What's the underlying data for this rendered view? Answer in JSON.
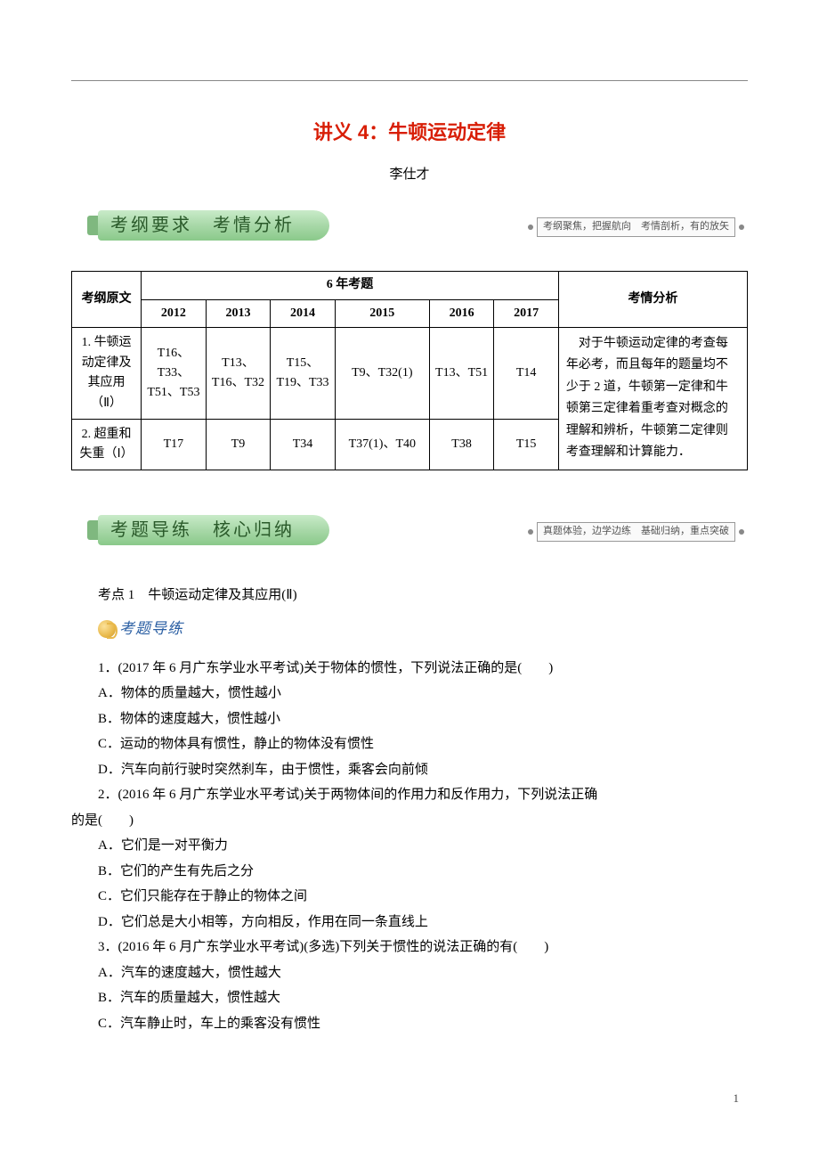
{
  "doc": {
    "title": "讲义 4：牛顿运动定律",
    "author": "李仕才"
  },
  "section1": {
    "ribbon": "考纲要求　考情分析",
    "note": "考纲聚焦，把握航向　考情剖析，有的放矢"
  },
  "table": {
    "header_outline": "考纲原文",
    "header_years_group": "6 年考题",
    "header_analysis": "考情分析",
    "years": [
      "2012",
      "2013",
      "2014",
      "2015",
      "2016",
      "2017"
    ],
    "rows": [
      {
        "outline": "1. 牛顿运动定律及其应用（Ⅱ）",
        "cells": [
          "T16、T33、T51、T53",
          "T13、T16、T32",
          "T15、T19、T33",
          "T9、T32(1)",
          "T13、T51",
          "T14"
        ]
      },
      {
        "outline": "2. 超重和失重（Ⅰ）",
        "cells": [
          "T17",
          "T9",
          "T34",
          "T37(1)、T40",
          "T38",
          "T15"
        ]
      }
    ],
    "analysis": "对于牛顿运动定律的考查每年必考，而且每年的题量均不少于 2 道，牛顿第一定律和牛顿第三定律着重考查对概念的理解和辨析，牛顿第二定律则考查理解和计算能力．"
  },
  "section2": {
    "ribbon": "考题导练　核心归纳",
    "note": "真题体验，边学边练　基础归纳，重点突破"
  },
  "topic1": {
    "heading": "考点 1　牛顿运动定律及其应用(Ⅱ)",
    "badge": "考题导练"
  },
  "q1": {
    "stem": "1．(2017 年 6 月广东学业水平考试)关于物体的惯性，下列说法正确的是(　　)",
    "A": "A．物体的质量越大，惯性越小",
    "B": "B．物体的速度越大，惯性越小",
    "C": "C．运动的物体具有惯性，静止的物体没有惯性",
    "D": "D．汽车向前行驶时突然刹车，由于惯性，乘客会向前倾"
  },
  "q2": {
    "stem_a": "2．(2016 年 6 月广东学业水平考试)关于两物体间的作用力和反作用力，下列说法正确",
    "stem_b": "的是(　　)",
    "A": "A．它们是一对平衡力",
    "B": "B．它们的产生有先后之分",
    "C": "C．它们只能存在于静止的物体之间",
    "D": "D．它们总是大小相等，方向相反，作用在同一条直线上"
  },
  "q3": {
    "stem": "3．(2016 年 6 月广东学业水平考试)(多选)下列关于惯性的说法正确的有(　　)",
    "A": "A．汽车的速度越大，惯性越大",
    "B": "B．汽车的质量越大，惯性越大",
    "C": "C．汽车静止时，车上的乘客没有惯性"
  },
  "page_number": "1"
}
